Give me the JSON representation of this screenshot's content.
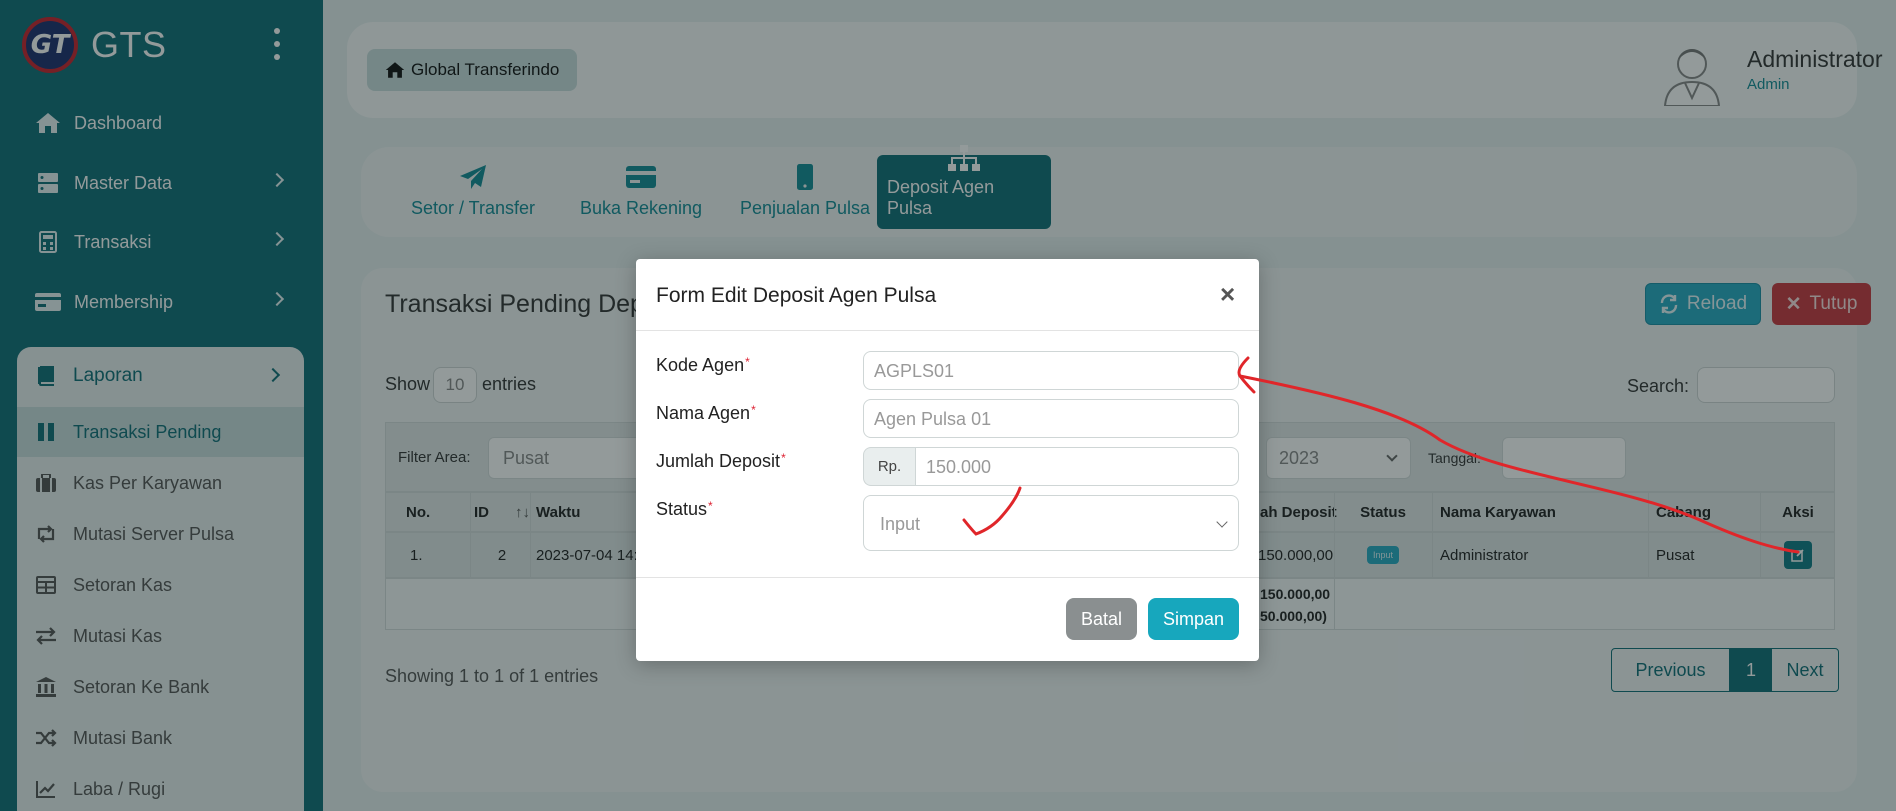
{
  "brand": {
    "logo_text": "GT",
    "name": "GTS"
  },
  "sidebar": {
    "items": [
      {
        "label": "Dashboard",
        "icon": "home-icon"
      },
      {
        "label": "Master Data",
        "icon": "server-icon"
      },
      {
        "label": "Transaksi",
        "icon": "calculator-icon"
      },
      {
        "label": "Membership",
        "icon": "card-icon"
      }
    ],
    "laporan": {
      "label": "Laporan",
      "items": [
        {
          "label": "Transaksi Pending"
        },
        {
          "label": "Kas Per Karyawan"
        },
        {
          "label": "Mutasi Server Pulsa"
        },
        {
          "label": "Setoran Kas"
        },
        {
          "label": "Mutasi Kas"
        },
        {
          "label": "Setoran Ke Bank"
        },
        {
          "label": "Mutasi Bank"
        },
        {
          "label": "Laba / Rugi"
        }
      ]
    }
  },
  "header": {
    "home_label": "Global Transferindo",
    "user_name": "Administrator",
    "user_role": "Admin"
  },
  "tabs": [
    {
      "label": "Setor / Transfer"
    },
    {
      "label": "Buka Rekening"
    },
    {
      "label": "Penjualan Pulsa"
    },
    {
      "label": "Deposit Agen Pulsa"
    }
  ],
  "content": {
    "title": "Transaksi Pending Dep",
    "reload_label": "Reload",
    "tutup_label": "Tutup",
    "show_label": "Show",
    "entries_value": "10",
    "entries_label": "entries",
    "search_label": "Search:",
    "filter_label": "Filter Area:",
    "filter_area": "Pusat",
    "filter_year": "2023",
    "tanggal_label": "Tanggal:",
    "columns": {
      "no": "No.",
      "id": "ID",
      "waktu": "Waktu",
      "deposit": "ah Deposit",
      "status": "Status",
      "karyawan": "Nama Karyawan",
      "cabang": "Cabang",
      "aksi": "Aksi"
    },
    "row": {
      "no": "1.",
      "id": "2",
      "waktu": "2023-07-04 14:",
      "deposit": "150.000,00",
      "status": "Input",
      "karyawan": "Administrator",
      "cabang": "Pusat"
    },
    "total_1": "150.000,00",
    "total_2": "50.000,00)",
    "showing": "Showing 1 to 1 of 1 entries",
    "pagination": {
      "prev": "Previous",
      "current": "1",
      "next": "Next"
    }
  },
  "modal": {
    "title": "Form Edit Deposit Agen Pulsa",
    "close": "×",
    "fields": {
      "kode_agen_label": "Kode Agen",
      "kode_agen_value": "AGPLS01",
      "nama_agen_label": "Nama Agen",
      "nama_agen_value": "Agen Pulsa 01",
      "jumlah_label": "Jumlah Deposit",
      "jumlah_prefix": "Rp.",
      "jumlah_value": "150.000",
      "status_label": "Status",
      "status_value": "Input"
    },
    "required_mark": "*",
    "batal_label": "Batal",
    "simpan_label": "Simpan"
  },
  "colors": {
    "sidebar": "#0f6d77",
    "accent": "#138a96",
    "info": "#27a9c3",
    "danger": "#c8383f",
    "annotation": "#e0262a"
  }
}
